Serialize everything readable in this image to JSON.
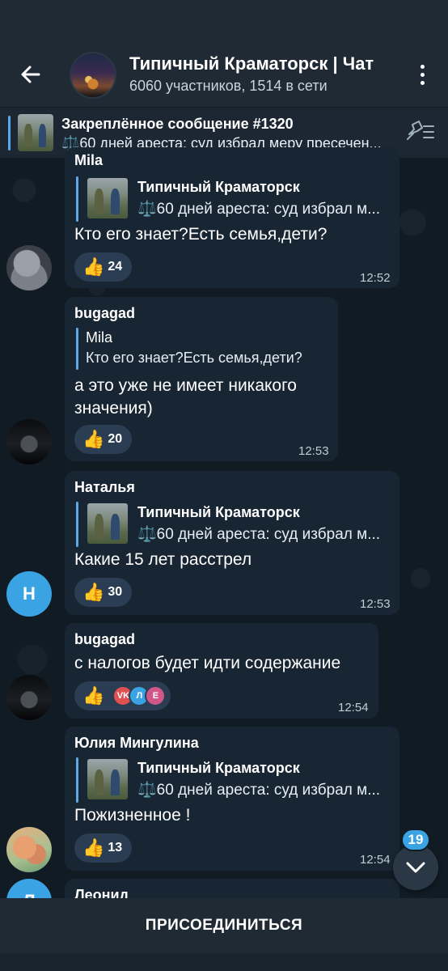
{
  "header": {
    "title": "Типичный Краматорск | Чат",
    "subtitle": "6060 участников, 1514 в сети"
  },
  "pinned": {
    "title": "Закреплённое сообщение #1320",
    "text": "⚖️60 дней ареста: суд избрал меру пресечен..."
  },
  "messages": [
    {
      "sender": "Mila",
      "reply_title": "Типичный Краматорск",
      "reply_text": "⚖️60 дней ареста: суд избрал м...",
      "text": "Кто его знает?Есть семья,дети?",
      "reaction_emoji": "👍",
      "reaction_count": "24",
      "time": "12:52"
    },
    {
      "sender": "bugagad",
      "reply_title": "Mila",
      "reply_text": "Кто его знает?Есть семья,дети?",
      "text_line1": "а это уже не имеет никакого",
      "text_line2": "значения)",
      "reaction_emoji": "👍",
      "reaction_count": "20",
      "time": "12:53"
    },
    {
      "sender": "Наталья",
      "avatar_letter": "Н",
      "reply_title": "Типичный Краматорск",
      "reply_text": "⚖️60 дней ареста: суд избрал м...",
      "text": "Какие 15 лет расстрел",
      "reaction_emoji": "👍",
      "reaction_count": "30",
      "time": "12:53"
    },
    {
      "sender": "bugagad",
      "text": "с налогов будет идти содержание",
      "reaction_emoji": "👍",
      "reactor_initials": [
        "VK",
        "Л",
        "E"
      ],
      "time": "12:54"
    },
    {
      "sender": "Юлия Мингулина",
      "reply_title": "Типичный Краматорск",
      "reply_text": "⚖️60 дней ареста: суд избрал м...",
      "text": "Пожизненное !",
      "reaction_emoji": "👍",
      "reaction_count": "13",
      "time": "12:54"
    },
    {
      "sender": "Леонид",
      "avatar_letter": "Л"
    }
  ],
  "unread_badge": "19",
  "join_label": "ПРИСОЕДИНИТЬСЯ",
  "colors": {
    "accent": "#5da8e8",
    "bubble": "#182533",
    "header": "#1f2a35",
    "reaction": "#2b3d52",
    "letter_avatar": "#3aa3e3"
  }
}
